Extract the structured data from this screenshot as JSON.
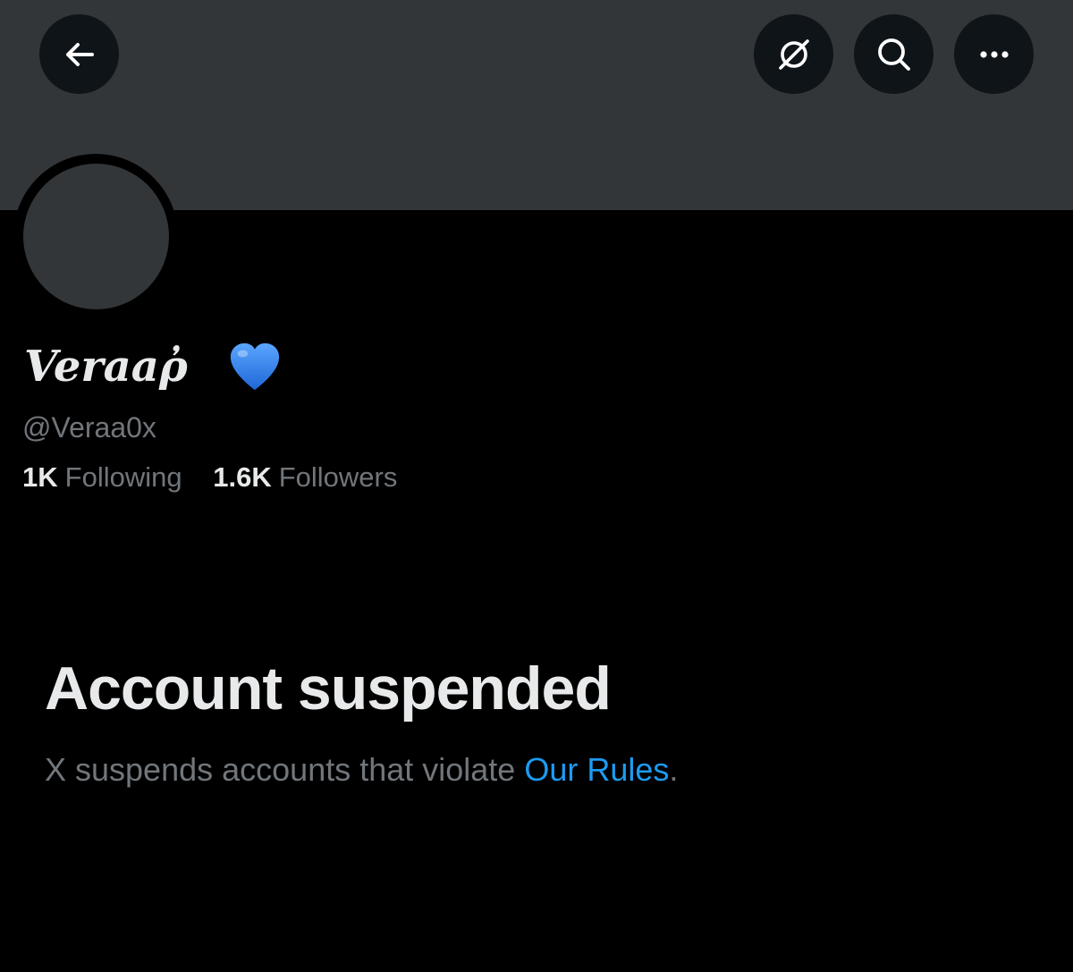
{
  "header": {
    "back_icon": "arrow-left-icon",
    "grok_icon": "grok-slash-circle-icon",
    "search_icon": "search-icon",
    "more_icon": "more-horizontal-icon"
  },
  "profile": {
    "display_name": "Veraaῤ",
    "name_emoji": "blue-heart-icon",
    "handle": "@Veraa0x",
    "following_count": "1K",
    "following_label": "Following",
    "followers_count": "1.6K",
    "followers_label": "Followers"
  },
  "notice": {
    "title": "Account suspended",
    "text_prefix": "X suspends accounts that violate ",
    "link_text": "Our Rules",
    "text_suffix": "."
  },
  "colors": {
    "background": "#000000",
    "banner": "#333639",
    "button_bg": "#0f1419",
    "primary_text": "#e7e9ea",
    "secondary_text": "#71767b",
    "link": "#1d9bf0",
    "heart": "#2f7fe8"
  }
}
